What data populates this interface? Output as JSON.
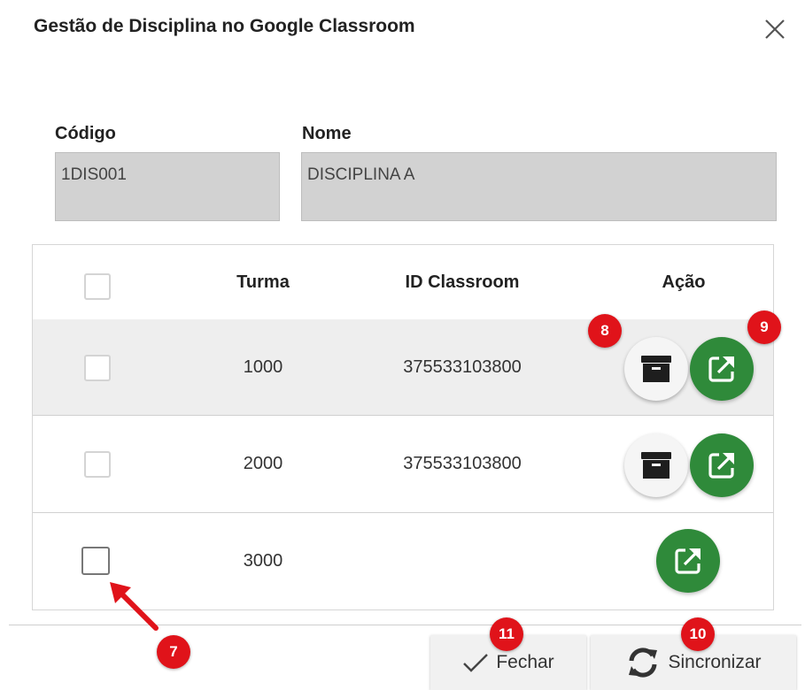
{
  "dialog": {
    "title": "Gestão de Disciplina no Google Classroom"
  },
  "form": {
    "codigo_label": "Código",
    "codigo_value": "1DIS001",
    "nome_label": "Nome",
    "nome_value": "DISCIPLINA A"
  },
  "table": {
    "headers": {
      "turma": "Turma",
      "id_classroom": "ID Classroom",
      "acao": "Ação"
    },
    "rows": [
      {
        "turma": "1000",
        "id_classroom": "375533103800",
        "actions": [
          "archive",
          "open-external"
        ]
      },
      {
        "turma": "2000",
        "id_classroom": "375533103800",
        "actions": [
          "archive",
          "open-external"
        ]
      },
      {
        "turma": "3000",
        "id_classroom": "",
        "actions": [
          "open-external"
        ]
      }
    ]
  },
  "annotations": {
    "badge_7": "7",
    "badge_8": "8",
    "badge_9": "9",
    "badge_10": "10",
    "badge_11": "11"
  },
  "footer": {
    "fechar_label": "Fechar",
    "sincronizar_label": "Sincronizar"
  },
  "icons": {
    "close": "close-icon",
    "archive": "archive-box-icon",
    "open": "external-link-icon",
    "check": "check-icon",
    "sync": "sync-icon",
    "arrow": "arrow-icon"
  },
  "colors": {
    "open_button": "#2f8a3a",
    "badge": "#e0131a",
    "readonly_field": "#d2d2d2",
    "highlight_row": "#eeeeee"
  }
}
